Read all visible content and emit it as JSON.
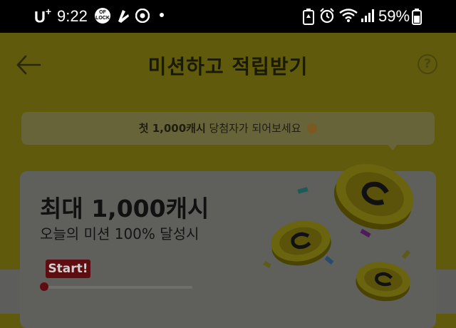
{
  "status_bar": {
    "carrier": "U",
    "carrier_plus": "+",
    "time": "9:22",
    "battery_pct": "59%",
    "icons": [
      "lock-badge-icon",
      "hand-icon",
      "chrome-icon",
      "dot-icon",
      "battery-saver-icon",
      "alarm-icon",
      "wifi-icon",
      "signal-icon",
      "battery-icon"
    ]
  },
  "header": {
    "title": "미션하고 적립받기",
    "back_icon": "back-arrow-icon",
    "help_icon": "help-icon",
    "help_glyph": "?"
  },
  "banner": {
    "prefix": "첫 1,000캐시",
    "suffix": " 당첨자가 되어보세요"
  },
  "card": {
    "title": "최대 1,000캐시",
    "subtitle": "오늘의 미션 100% 달성시",
    "start_label": "Start!",
    "progress": 0
  },
  "colors": {
    "overlay_bg": "#5f5a0c",
    "card_bg": "#5f5f5c",
    "start_badge": "#5e0d10"
  }
}
